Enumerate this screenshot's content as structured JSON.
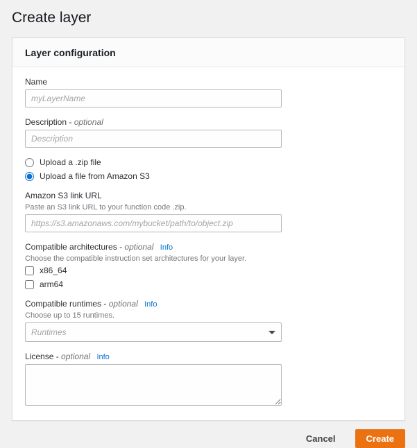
{
  "page": {
    "title": "Create layer"
  },
  "panel": {
    "header": "Layer configuration"
  },
  "optional": "optional",
  "info": "Info",
  "name": {
    "label": "Name",
    "placeholder": "myLayerName"
  },
  "description": {
    "label": "Description",
    "placeholder": "Description"
  },
  "upload": {
    "zip_label": "Upload a .zip file",
    "s3_label": "Upload a file from Amazon S3"
  },
  "s3": {
    "label": "Amazon S3 link URL",
    "help": "Paste an S3 link URL to your function code .zip.",
    "placeholder": "https://s3.amazonaws.com/mybucket/path/to/object.zip"
  },
  "arch": {
    "label": "Compatible architectures",
    "help": "Choose the compatible instruction set architectures for your layer.",
    "options": [
      "x86_64",
      "arm64"
    ]
  },
  "runtimes": {
    "label": "Compatible runtimes",
    "help": "Choose up to 15 runtimes.",
    "placeholder": "Runtimes"
  },
  "license": {
    "label": "License"
  },
  "buttons": {
    "cancel": "Cancel",
    "create": "Create"
  }
}
